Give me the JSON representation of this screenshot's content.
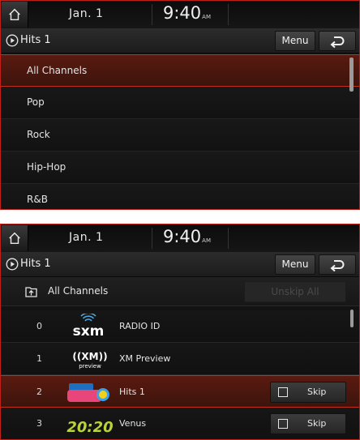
{
  "status": {
    "date": "Jan.  1",
    "time": "9:40",
    "ampm": "AM"
  },
  "title_bar": {
    "title": "Hits 1",
    "menu_label": "Menu",
    "back_icon": "back-arrow-icon",
    "play_icon": "play-circle-icon"
  },
  "top_screen": {
    "categories": [
      {
        "label": "All Channels",
        "selected": true
      },
      {
        "label": "Pop",
        "selected": false
      },
      {
        "label": "Rock",
        "selected": false
      },
      {
        "label": "Hip-Hop",
        "selected": false
      },
      {
        "label": "R&B",
        "selected": false
      }
    ]
  },
  "bottom_screen": {
    "sub_header": {
      "title": "All Channels",
      "unskip_label": "Unskip All"
    },
    "channels": [
      {
        "number": "0",
        "logo": "sxm-logo",
        "name": "RADIO ID",
        "skip": false
      },
      {
        "number": "1",
        "logo": "xm-preview-logo",
        "name": "XM Preview",
        "skip": false
      },
      {
        "number": "2",
        "logo": "sirius-xm-hits1-logo",
        "name": "Hits 1",
        "skip": true,
        "selected": true
      },
      {
        "number": "3",
        "logo": "20on20-logo",
        "name": "Venus",
        "skip": true
      }
    ],
    "skip_label": "Skip"
  },
  "colors": {
    "accent_red": "#c0301c",
    "selected_bg": "#4a170e",
    "background": "#121212",
    "frame_border": "#c0201a"
  }
}
